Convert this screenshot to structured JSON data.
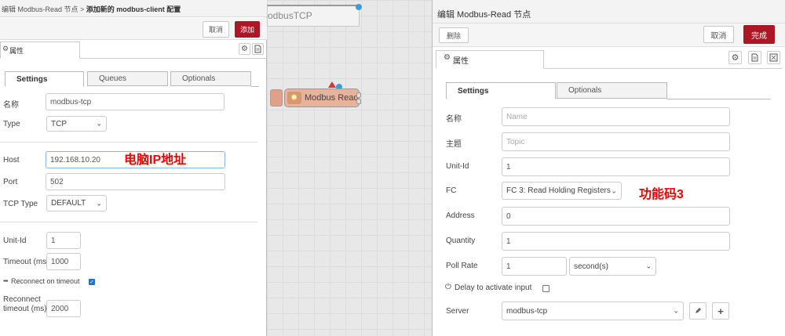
{
  "canvas": {
    "tab_label": "odbusTCP",
    "node_label": "Modbus Read"
  },
  "left": {
    "title_prefix": "编辑 Modbus-Read 节点 > ",
    "title_main": "添加新的 modbus-client 配置",
    "cancel_label": "取消",
    "add_label": "添加",
    "props_label": "属性",
    "tabs": [
      "Settings",
      "Queues",
      "Optionals"
    ],
    "name_label": "名称",
    "name_value": "modbus-tcp",
    "type_label": "Type",
    "type_value": "TCP",
    "host_label": "Host",
    "host_value": "192.168.10.20",
    "host_annotation": "电脑IP地址",
    "port_label": "Port",
    "port_value": "502",
    "tcp_type_label": "TCP Type",
    "tcp_type_value": "DEFAULT",
    "unit_id_label": "Unit-Id",
    "unit_id_value": "1",
    "timeout_label": "Timeout (ms)",
    "timeout_value": "1000",
    "reconnect_label": "Reconnect on timeout",
    "reconnect_timeout_label_1": "Reconnect",
    "reconnect_timeout_label_2": "timeout (ms)",
    "reconnect_timeout_value": "2000"
  },
  "right": {
    "title": "编辑 Modbus-Read 节点",
    "delete_label": "删除",
    "cancel_label": "取消",
    "done_label": "完成",
    "props_label": "属性",
    "tabs": [
      "Settings",
      "Optionals"
    ],
    "name_label": "名称",
    "name_placeholder": "Name",
    "topic_label": "主题",
    "topic_placeholder": "Topic",
    "unit_id_label": "Unit-Id",
    "unit_id_value": "1",
    "fc_label": "FC",
    "fc_value": "FC 3: Read Holding Registers",
    "fc_annotation": "功能码3",
    "address_label": "Address",
    "address_value": "0",
    "quantity_label": "Quantity",
    "quantity_value": "1",
    "poll_rate_label": "Poll Rate",
    "poll_rate_value": "1",
    "poll_unit_value": "second(s)",
    "delay_label": "Delay to activate input",
    "server_label": "Server",
    "server_value": "modbus-tcp"
  },
  "colors": {
    "accent_red": "#ad1625",
    "annotation_red": "#ee0000",
    "node_fill": "#e9b29a",
    "status_blue": "#3a9fd6"
  },
  "icons": [
    "gear-icon",
    "document-icon",
    "frame-icon",
    "pencil-icon",
    "plus-icon",
    "power-icon",
    "grid-icon",
    "chevron-down-icon"
  ]
}
